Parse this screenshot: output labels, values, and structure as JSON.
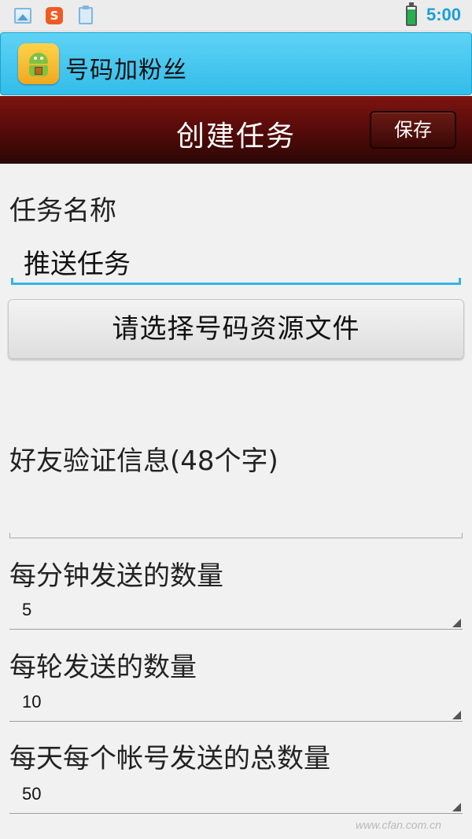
{
  "status_bar": {
    "icons": [
      "gallery-icon",
      "sogou-input-icon",
      "clipboard-icon"
    ],
    "sogou_glyph": "S",
    "battery_level": 0.85,
    "time": "5:00",
    "time_color": "#1a9fd6"
  },
  "app_bar": {
    "title": "号码加粉丝",
    "icon": "android-app-icon",
    "color": "#3cc3ee"
  },
  "header": {
    "title": "创建任务",
    "save_label": "保存",
    "color": "#5a0c0a"
  },
  "form": {
    "task_name_label": "任务名称",
    "task_name_value": "推送任务",
    "select_file_button": "请选择号码资源文件",
    "verify_label": "好友验证信息(48个字)",
    "verify_value": "",
    "per_minute_label": "每分钟发送的数量",
    "per_minute_value": "5",
    "per_round_label": "每轮发送的数量",
    "per_round_value": "10",
    "per_day_label": "每天每个帐号发送的总数量",
    "per_day_value": "50",
    "accent_color": "#33b5e5"
  },
  "watermark": "www.cfan.com.cn"
}
